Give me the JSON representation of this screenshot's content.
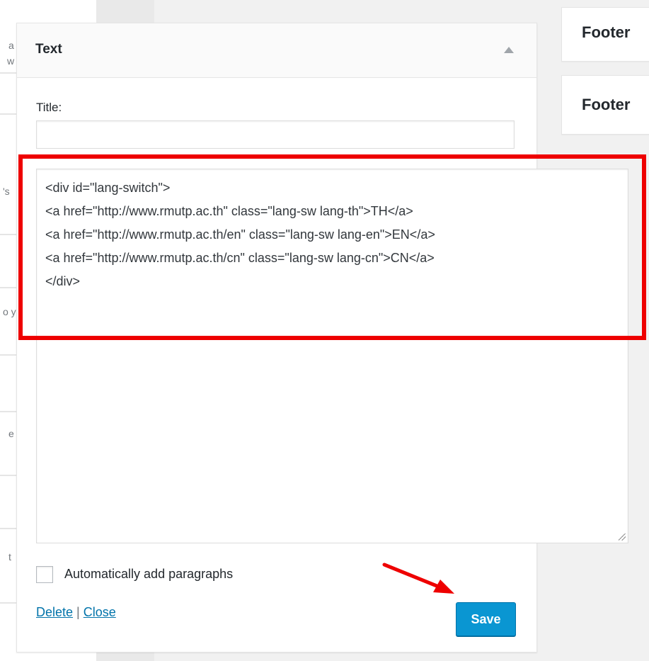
{
  "widget": {
    "title": "Text",
    "title_field_label": "Title:",
    "title_field_value": "",
    "text_lines": [
      "<div id=\"lang-switch\">",
      "<a href=\"http://www.rmutp.ac.th\" class=\"lang-sw lang-th\">TH</a>",
      "<a href=\"http://www.rmutp.ac.th/en\" class=\"lang-sw lang-en\">EN</a>",
      "<a href=\"http://www.rmutp.ac.th/cn\" class=\"lang-sw lang-cn\">CN</a>",
      "</div>"
    ],
    "auto_paragraphs_label": "Automatically add paragraphs",
    "auto_paragraphs_checked": false,
    "delete_label": "Delete",
    "separator": "|",
    "close_label": "Close",
    "save_label": "Save"
  },
  "sidebars": [
    {
      "title": "Footer"
    },
    {
      "title": "Footer"
    }
  ],
  "left_fragments": [
    "a",
    "w",
    "'s",
    "o y",
    "e",
    "t"
  ],
  "annotation": {
    "highlight_color": "#ee0000",
    "arrow_color": "#ee0000"
  },
  "colors": {
    "primary_button": "#0a96d2",
    "link": "#0073aa"
  }
}
